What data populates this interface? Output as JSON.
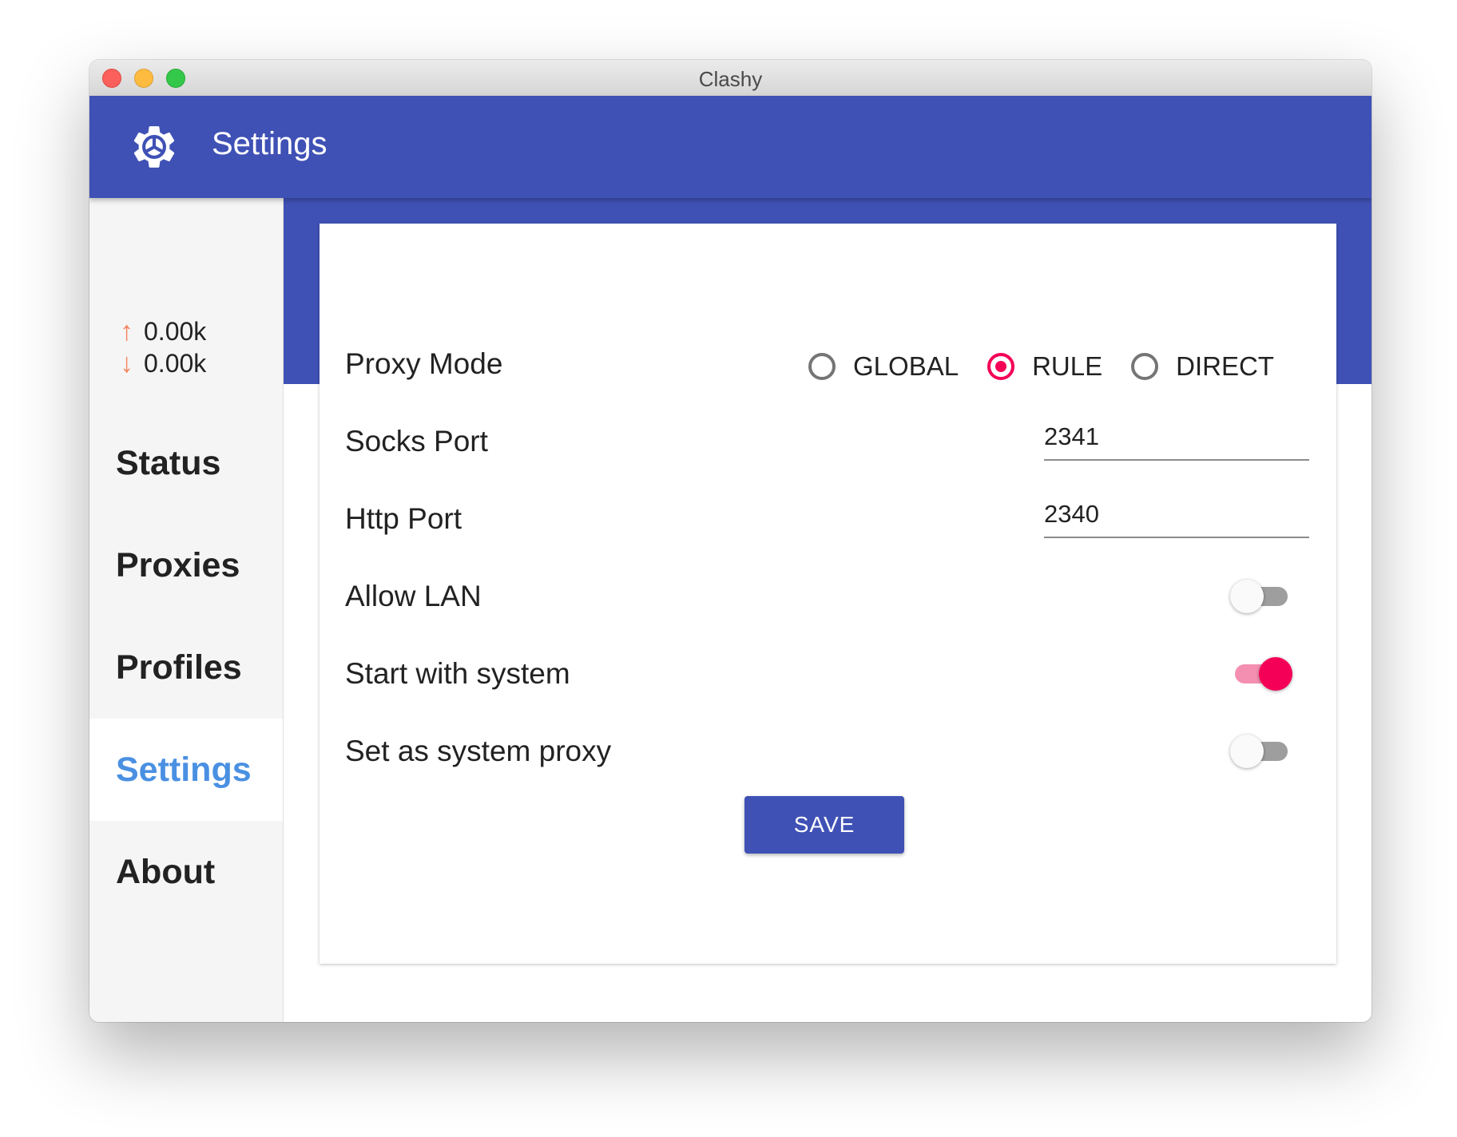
{
  "window": {
    "title": "Clashy"
  },
  "appbar": {
    "icon": "gear-icon",
    "title": "Settings"
  },
  "sidebar": {
    "upload_speed": "0.00k",
    "download_speed": "0.00k",
    "items": [
      {
        "label": "Status",
        "active": false
      },
      {
        "label": "Proxies",
        "active": false
      },
      {
        "label": "Profiles",
        "active": false
      },
      {
        "label": "Settings",
        "active": true
      },
      {
        "label": "About",
        "active": false
      }
    ]
  },
  "settings": {
    "proxy_mode": {
      "label": "Proxy Mode",
      "options": [
        "GLOBAL",
        "RULE",
        "DIRECT"
      ],
      "selected": "RULE"
    },
    "socks_port": {
      "label": "Socks Port",
      "value": "2341"
    },
    "http_port": {
      "label": "Http Port",
      "value": "2340"
    },
    "allow_lan": {
      "label": "Allow LAN",
      "enabled": false
    },
    "start_with_system": {
      "label": "Start with system",
      "enabled": true
    },
    "system_proxy": {
      "label": "Set as system proxy",
      "enabled": false
    },
    "save_label": "SAVE"
  },
  "colors": {
    "primary": "#3f51b5",
    "accent": "#f50057",
    "active_nav": "#4a90e2",
    "speed_arrow": "#f4845f"
  }
}
